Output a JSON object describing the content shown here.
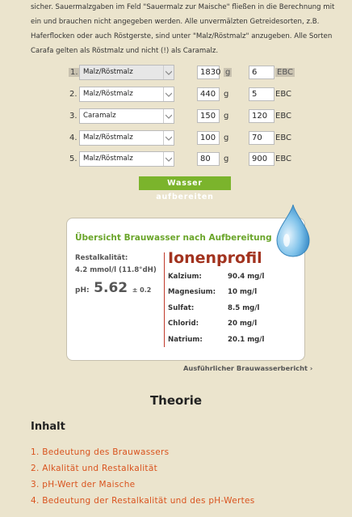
{
  "intro": "sicher. Sauermalzgaben im Feld \"Sauermalz zur Maische\" fließen in die Berechnung mit ein und brauchen nicht angegeben werden. Alle unvermälzten Getreidesorten, z.B. Haferflocken oder auch Röstgerste, sind unter \"Malz/Röstmalz\" anzugeben. Alle Sorten Carafa gelten als Röstmalz und nicht (!) als Caramalz.",
  "malts": [
    {
      "num": "1.",
      "type": "Malz/Röstmalz",
      "amount": "1830",
      "amount_unit": "g",
      "ebc": "6",
      "ebc_unit": "EBC"
    },
    {
      "num": "2.",
      "type": "Malz/Röstmalz",
      "amount": "440",
      "amount_unit": "g",
      "ebc": "5",
      "ebc_unit": "EBC"
    },
    {
      "num": "3.",
      "type": "Caramalz",
      "amount": "150",
      "amount_unit": "g",
      "ebc": "120",
      "ebc_unit": "EBC"
    },
    {
      "num": "4.",
      "type": "Malz/Röstmalz",
      "amount": "100",
      "amount_unit": "g",
      "ebc": "70",
      "ebc_unit": "EBC"
    },
    {
      "num": "5.",
      "type": "Malz/Röstmalz",
      "amount": "80",
      "amount_unit": "g",
      "ebc": "900",
      "ebc_unit": "EBC"
    }
  ],
  "button_label": "Wasser aufbereiten",
  "summary": {
    "title": "Übersicht Brauwasser nach Aufbereitung",
    "restalkalitaet_label": "Restalkalität:",
    "restalkalitaet_value": "4.2 mmol/l (11.8°dH)",
    "ph_label": "pH:",
    "ph_value": "5.62",
    "ph_tolerance": "± 0.2",
    "ion_title": "Ionenprofil",
    "ions": [
      {
        "name": "Kalzium:",
        "value": "90.4 mg/l"
      },
      {
        "name": "Magnesium:",
        "value": "10 mg/l"
      },
      {
        "name": "Sulfat:",
        "value": "8.5 mg/l"
      },
      {
        "name": "Chlorid:",
        "value": "20 mg/l"
      },
      {
        "name": "Natrium:",
        "value": "20.1 mg/l"
      }
    ]
  },
  "report_link": "Ausführlicher Brauwasserbericht ›",
  "theorie_title": "Theorie",
  "inhalt_title": "Inhalt",
  "toc": [
    "1. Bedeutung des Brauwassers",
    "2. Alkalität und Restalkalität",
    "3. pH-Wert der Maische",
    "4. Bedeutung der Restalkalität und des pH-Wertes"
  ],
  "colors": {
    "accent_green": "#7bb42c",
    "ion_title": "#a2331f",
    "toc_link": "#d9531e",
    "background": "#ebe4cd"
  },
  "icons": [
    "chevron-down-icon",
    "water-drop-icon"
  ]
}
